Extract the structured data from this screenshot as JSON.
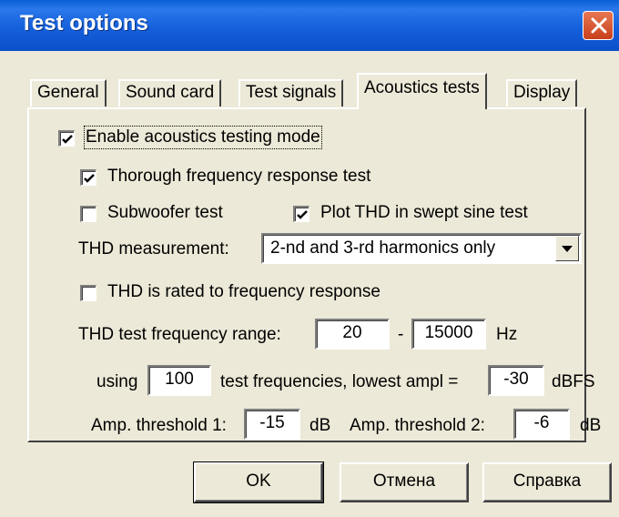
{
  "window": {
    "title": "Test options",
    "close_icon": "close-icon"
  },
  "tabs": [
    {
      "label": "General",
      "active": false
    },
    {
      "label": "Sound card",
      "active": false
    },
    {
      "label": "Test signals",
      "active": false
    },
    {
      "label": "Acoustics tests",
      "active": true
    },
    {
      "label": "Display",
      "active": false
    }
  ],
  "acoustics": {
    "enable_mode": {
      "label": "Enable acoustics testing mode",
      "checked": true
    },
    "thorough_freq": {
      "label": "Thorough frequency response test",
      "checked": true
    },
    "subwoofer": {
      "label": "Subwoofer test",
      "checked": false
    },
    "plot_thd": {
      "label": "Plot THD in swept sine test",
      "checked": true
    },
    "thd_measurement": {
      "label": "THD measurement:",
      "selected": "2-nd and 3-rd harmonics only"
    },
    "thd_rated": {
      "label": "THD is rated to frequency response",
      "checked": false
    },
    "thd_range": {
      "label": "THD test frequency range:",
      "from": "20",
      "sep": "-",
      "to": "15000",
      "unit": "Hz"
    },
    "test_freqs": {
      "using_label": "using",
      "count": "100",
      "middle_label": "test frequencies, lowest ampl =",
      "lowest_ampl": "-30",
      "unit": "dBFS"
    },
    "threshold1": {
      "label": "Amp. threshold 1:",
      "value": "-15",
      "unit": "dB"
    },
    "threshold2": {
      "label": "Amp. threshold 2:",
      "value": "-6",
      "unit": "dB"
    }
  },
  "buttons": {
    "ok": "OK",
    "cancel": "Отмена",
    "help": "Справка"
  }
}
